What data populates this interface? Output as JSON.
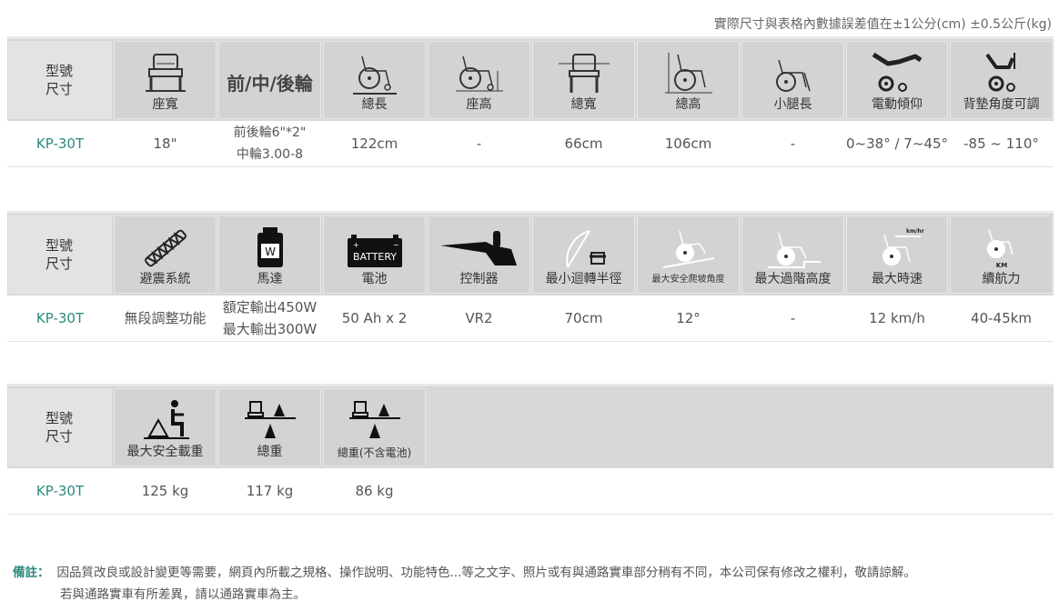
{
  "tolerance_note": "實際尺寸與表格內數據誤差值在±1公分(cm) ±0.5公斤(kg)",
  "model_label_line1": "型號",
  "model_label_line2": "尺寸",
  "table1": {
    "headers": [
      {
        "label": "座寬",
        "icon": "seat-width-icon"
      },
      {
        "label": "前/中/後輪",
        "icon": "none"
      },
      {
        "label": "總長",
        "icon": "wheelchair-length-icon"
      },
      {
        "label": "座高",
        "icon": "wheelchair-seat-height-icon"
      },
      {
        "label": "總寬",
        "icon": "total-width-icon"
      },
      {
        "label": "總高",
        "icon": "wheelchair-height-icon"
      },
      {
        "label": "小腿長",
        "icon": "leg-length-icon"
      },
      {
        "label": "電動傾仰",
        "icon": "power-tilt-icon"
      },
      {
        "label": "背墊角度可調",
        "icon": "backrest-angle-icon"
      }
    ],
    "row": {
      "model": "KP-30T",
      "values": [
        "18\"",
        "前後輪6\"*2\" 中輪3.00-8",
        "122cm",
        "-",
        "66cm",
        "106cm",
        "-",
        "0~38° / 7~45°",
        "-85 ~ 110°"
      ]
    }
  },
  "table2": {
    "headers": [
      {
        "label": "避震系統",
        "icon": "shock-absorber-icon"
      },
      {
        "label": "馬達",
        "icon": "motor-icon",
        "badge": "W"
      },
      {
        "label": "電池",
        "icon": "battery-icon",
        "badge": "BATTERY"
      },
      {
        "label": "控制器",
        "icon": "controller-icon"
      },
      {
        "label": "最小迴轉半徑",
        "icon": "turning-radius-icon"
      },
      {
        "label": "最大安全爬坡角度",
        "icon": "climb-angle-icon"
      },
      {
        "label": "最大過階高度",
        "icon": "step-height-icon"
      },
      {
        "label": "最大時速",
        "icon": "max-speed-icon",
        "badge": "km/hr"
      },
      {
        "label": "續航力",
        "icon": "range-icon",
        "badge": "KM"
      }
    ],
    "row": {
      "model": "KP-30T",
      "values": [
        "無段調整功能",
        "額定輸出450W 最大輸出300W",
        "50 Ah x 2",
        "VR2",
        "70cm",
        "12°",
        "-",
        "12 km/h",
        "40-45km"
      ]
    }
  },
  "table3": {
    "headers": [
      {
        "label": "最大安全載重",
        "icon": "max-load-icon"
      },
      {
        "label": "總重",
        "icon": "total-weight-icon"
      },
      {
        "label": "總重(不含電池)",
        "icon": "weight-no-battery-icon"
      }
    ],
    "row": {
      "model": "KP-30T",
      "values": [
        "125 kg",
        "117 kg",
        "86 kg"
      ]
    }
  },
  "note": {
    "key": "備註：",
    "line1": "因品質改良或設計變更等需要，網頁內所載之規格、操作說明、功能特色...等之文字、照片或有與通路實車部分稍有不同，本公司保有修改之權利，敬請諒解。",
    "line2": "若與通路實車有所差異，請以通路實車為主。"
  }
}
